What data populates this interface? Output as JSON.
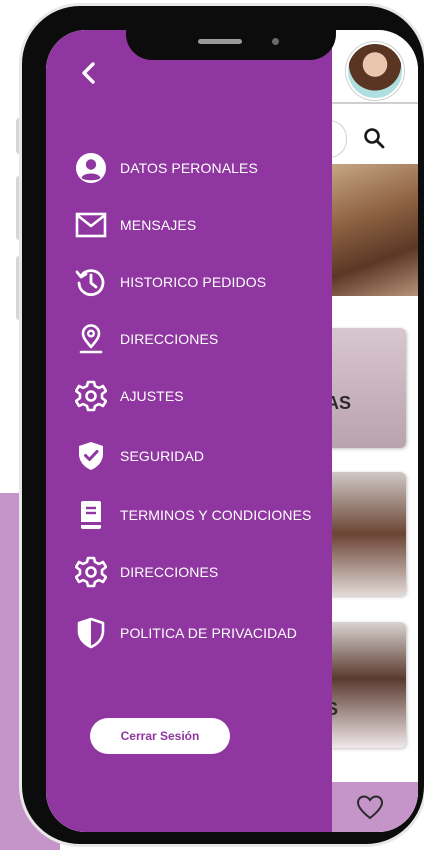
{
  "drawer": {
    "back_icon": "chevron-left-icon",
    "items": [
      {
        "label": "DATOS PERONALES",
        "icon": "user-circle-icon"
      },
      {
        "label": "MENSAJES",
        "icon": "envelope-icon"
      },
      {
        "label": "HISTORICO PEDIDOS",
        "icon": "history-icon"
      },
      {
        "label": "DIRECCIONES",
        "icon": "location-pin-icon"
      },
      {
        "label": "AJUSTES",
        "icon": "gear-icon"
      },
      {
        "label": "SEGURIDAD",
        "icon": "shield-check-icon"
      },
      {
        "label": "TERMINOS Y CONDICIONES",
        "icon": "book-icon"
      },
      {
        "label": "DIRECCIONES",
        "icon": "gear-icon"
      },
      {
        "label": "POLITICA DE PRIVACIDAD",
        "icon": "shield-half-icon"
      }
    ],
    "logout_label": "Cerrar Sesión"
  },
  "background_app": {
    "avatar": "avatar",
    "search_icon": "search-icon",
    "card_fragments": [
      "AS",
      "",
      "S"
    ],
    "favorite_icon": "heart-icon"
  },
  "colors": {
    "drawer": "#8f36a0",
    "accent_light": "#c594c8",
    "text_on_drawer": "#ffffff"
  }
}
